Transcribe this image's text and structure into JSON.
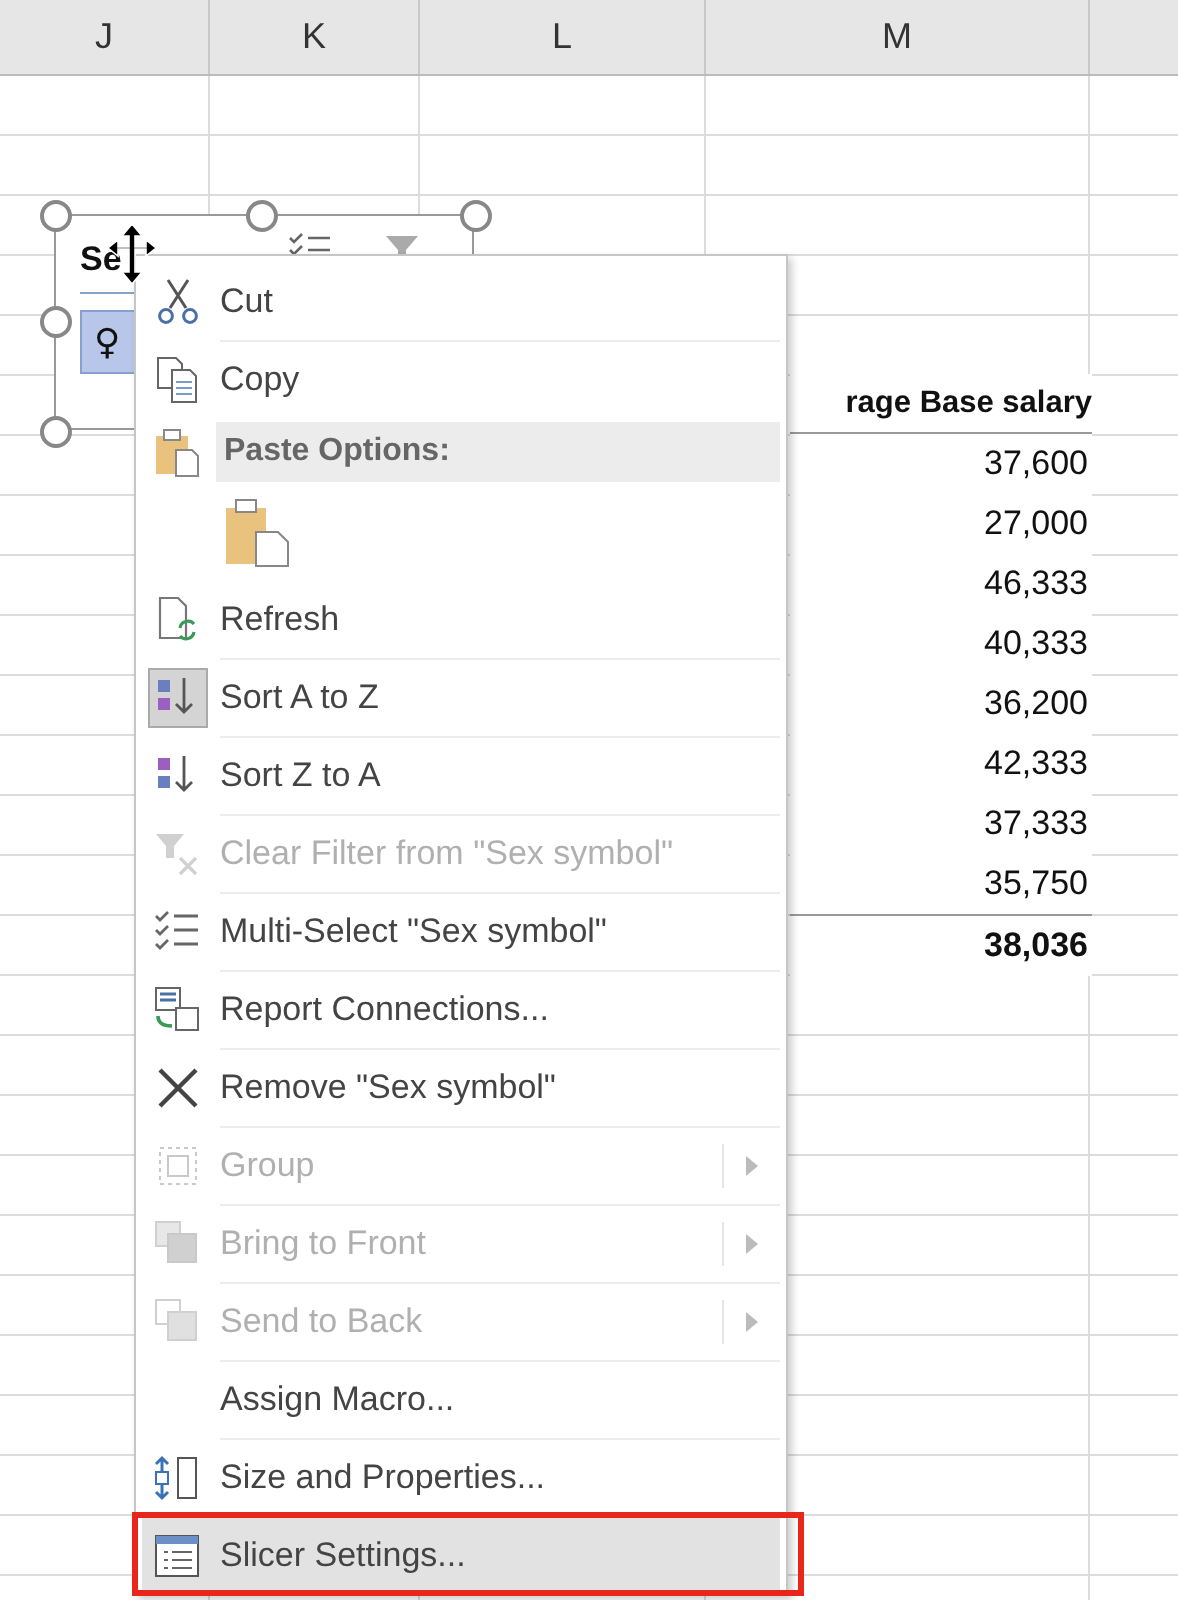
{
  "columns": [
    {
      "label": "J"
    },
    {
      "label": "K"
    },
    {
      "label": "L"
    },
    {
      "label": "M"
    }
  ],
  "slicer": {
    "title": "Se",
    "items": [
      {
        "label": "♀",
        "selected": true
      }
    ]
  },
  "pivot": {
    "header": "rage Base salary",
    "values": [
      "37,600",
      "27,000",
      "46,333",
      "40,333",
      "36,200",
      "42,333",
      "37,333",
      "35,750"
    ],
    "total": "38,036"
  },
  "context_menu": {
    "items": [
      {
        "kind": "command",
        "label": "Cut",
        "disabled": false,
        "submenu": false,
        "checked": false,
        "selected": false,
        "annotated": false
      },
      {
        "kind": "command",
        "label": "Copy",
        "disabled": false,
        "submenu": false,
        "checked": false,
        "selected": false,
        "annotated": false
      },
      {
        "kind": "header",
        "label": "Paste Options:"
      },
      {
        "kind": "paste_options"
      },
      {
        "kind": "command",
        "label": "Refresh",
        "disabled": false,
        "submenu": false,
        "checked": false,
        "selected": false,
        "annotated": false
      },
      {
        "kind": "command",
        "label": "Sort A to Z",
        "disabled": false,
        "submenu": false,
        "checked": true,
        "selected": false,
        "annotated": false
      },
      {
        "kind": "command",
        "label": "Sort Z to A",
        "disabled": false,
        "submenu": false,
        "checked": false,
        "selected": false,
        "annotated": false
      },
      {
        "kind": "command",
        "label": "Clear Filter from \"Sex symbol\"",
        "disabled": true,
        "submenu": false,
        "checked": false,
        "selected": false,
        "annotated": false
      },
      {
        "kind": "command",
        "label": "Multi-Select \"Sex symbol\"",
        "disabled": false,
        "submenu": false,
        "checked": false,
        "selected": false,
        "annotated": false
      },
      {
        "kind": "command",
        "label": "Report Connections...",
        "disabled": false,
        "submenu": false,
        "checked": false,
        "selected": false,
        "annotated": false
      },
      {
        "kind": "command",
        "label": "Remove \"Sex symbol\"",
        "disabled": false,
        "submenu": false,
        "checked": false,
        "selected": false,
        "annotated": false
      },
      {
        "kind": "command",
        "label": "Group",
        "disabled": true,
        "submenu": true,
        "checked": false,
        "selected": false,
        "annotated": false
      },
      {
        "kind": "command",
        "label": "Bring to Front",
        "disabled": true,
        "submenu": true,
        "checked": false,
        "selected": false,
        "annotated": false
      },
      {
        "kind": "command",
        "label": "Send to Back",
        "disabled": true,
        "submenu": true,
        "checked": false,
        "selected": false,
        "annotated": false
      },
      {
        "kind": "command",
        "label": "Assign Macro...",
        "disabled": false,
        "submenu": false,
        "checked": false,
        "selected": false,
        "annotated": false
      },
      {
        "kind": "command",
        "label": "Size and Properties...",
        "disabled": false,
        "submenu": false,
        "checked": false,
        "selected": false,
        "annotated": false
      },
      {
        "kind": "command",
        "label": "Slicer Settings...",
        "disabled": false,
        "submenu": false,
        "checked": false,
        "selected": true,
        "annotated": true
      }
    ]
  }
}
